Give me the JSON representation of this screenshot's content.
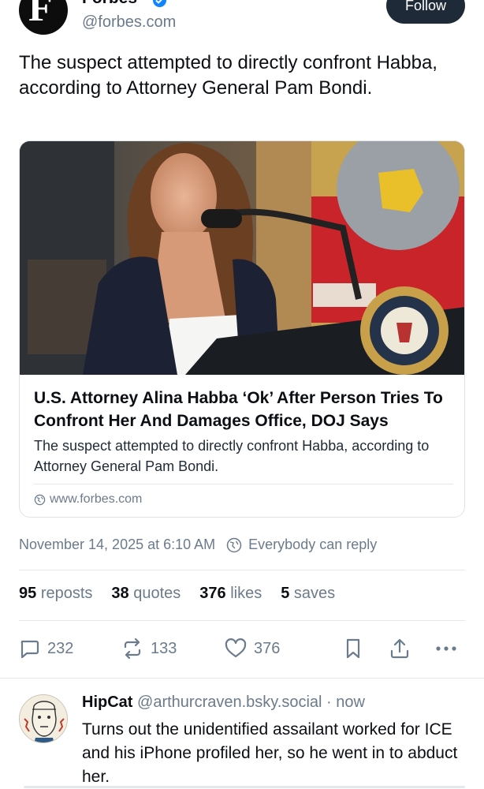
{
  "author": {
    "name": "Forbes",
    "handle": "@forbes.com",
    "avatar_letter": "F",
    "verified": true
  },
  "follow_label": "Follow",
  "post_text": "The suspect attempted to directly confront Habba, according to Attorney General Pam Bondi.",
  "card": {
    "title": "U.S. Attorney Alina Habba ‘Ok’ After Person Tries To Confront Her And Damages Office, DOJ Says",
    "description": "The suspect attempted to directly confront Habba, according to Attorney General Pam Bondi.",
    "domain": "www.forbes.com"
  },
  "meta": {
    "timestamp": "November 14, 2025 at 6:10 AM",
    "reply_setting": "Everybody can reply"
  },
  "stats": {
    "reposts_count": "95",
    "reposts_label": "reposts",
    "quotes_count": "38",
    "quotes_label": "quotes",
    "likes_count": "376",
    "likes_label": "likes",
    "saves_count": "5",
    "saves_label": "saves"
  },
  "actions": {
    "replies": "232",
    "reposts": "133",
    "likes": "376"
  },
  "reply": {
    "name": "HipCat",
    "handle": "@arthurcraven.bsky.social",
    "time": "· now",
    "text": "Turns out the unidentified assailant worked for ICE and his iPhone profiled her, so he went in to abduct her."
  },
  "colors": {
    "accent": "#1083fe",
    "muted": "#6b7b8c",
    "follow_bg": "#1e2a38"
  }
}
